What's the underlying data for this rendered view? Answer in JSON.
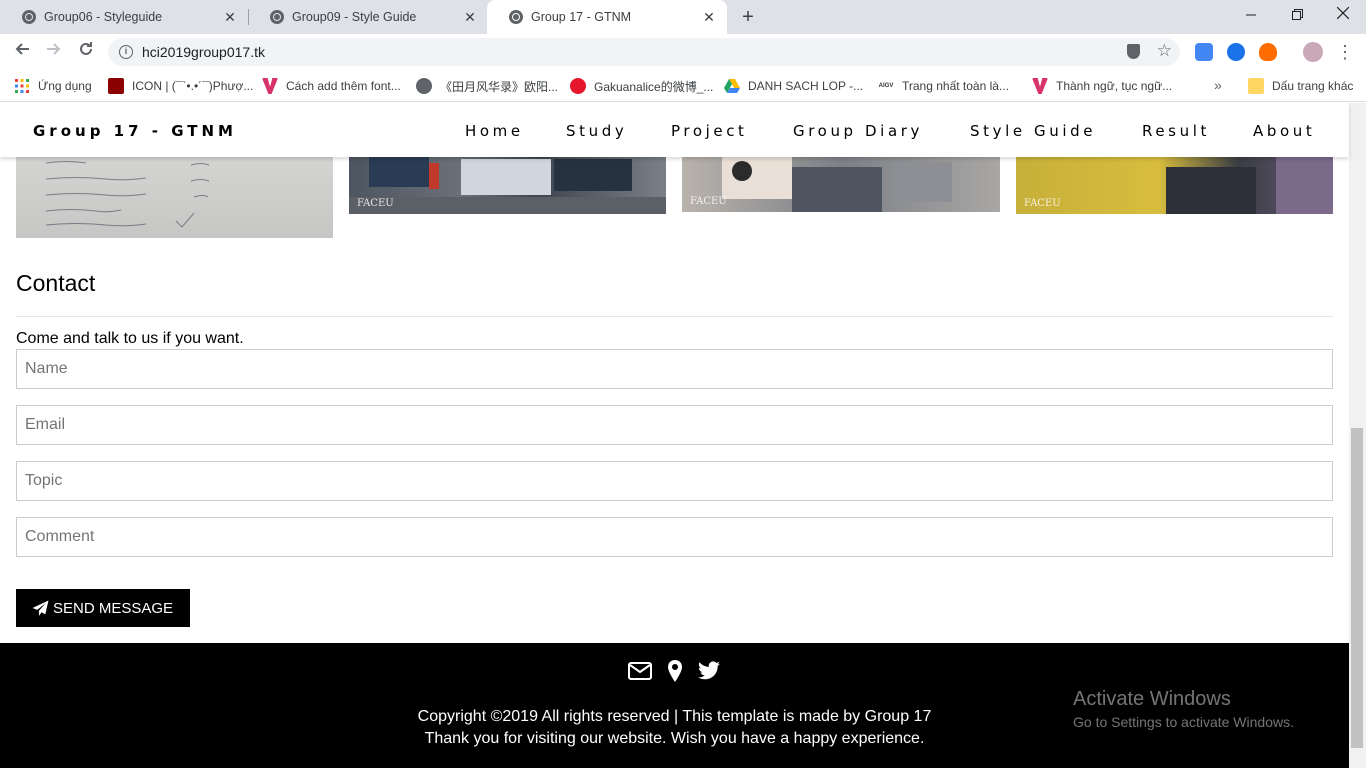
{
  "browser": {
    "tabs": [
      {
        "title": "Group06 - Styleguide"
      },
      {
        "title": "Group09 - Style Guide"
      },
      {
        "title": "Group 17 - GTNM"
      }
    ],
    "close_glyph": "✕",
    "new_tab_glyph": "+",
    "url": "hci2019group017.tk",
    "bookmarks": [
      {
        "label": "Ứng dụng",
        "icon": "apps-grid-icon",
        "color": "#e8453c"
      },
      {
        "label": "ICON | (¯`•.•´¯)Phượ...",
        "icon": "icon-site-icon",
        "color": "#8b0000"
      },
      {
        "label": "Cách add thêm font...",
        "icon": "v-site-icon",
        "color": "#d6336c"
      },
      {
        "label": "《田月风华录》欧阳...",
        "icon": "globe-icon",
        "color": "#5f6368"
      },
      {
        "label": "Gakuanalice的微博_...",
        "icon": "weibo-icon",
        "color": "#e6162d"
      },
      {
        "label": "DANH SACH LOP -...",
        "icon": "drive-icon",
        "color": "#1fa463"
      },
      {
        "label": "Trang nhất toàn là...",
        "icon": "aigv-icon",
        "color": "#333333"
      },
      {
        "label": "Thành ngữ, tục ngữ...",
        "icon": "v-site-icon",
        "color": "#d6336c"
      }
    ],
    "other_bookmarks": "Dấu trang khác",
    "more_glyph": "»"
  },
  "site": {
    "brand": "Group 17 - GTNM",
    "nav": [
      "Home",
      "Study",
      "Project",
      "Group Diary",
      "Style Guide",
      "Result",
      "About"
    ],
    "photo_watermark": "FACEU"
  },
  "contact": {
    "title": "Contact",
    "subtitle": "Come and talk to us if you want.",
    "name_placeholder": "Name",
    "email_placeholder": "Email",
    "topic_placeholder": "Topic",
    "comment_placeholder": "Comment",
    "send_label": "SEND MESSAGE"
  },
  "footer": {
    "icons": [
      "envelope-icon",
      "map-marker-icon",
      "twitter-icon"
    ],
    "copyright": "Copyright ©2019 All rights reserved | This template is made by Group 17",
    "thanks": "Thank you for visiting our website. Wish you have a happy experience."
  },
  "windows_watermark": {
    "title": "Activate Windows",
    "subtitle": "Go to Settings to activate Windows."
  }
}
